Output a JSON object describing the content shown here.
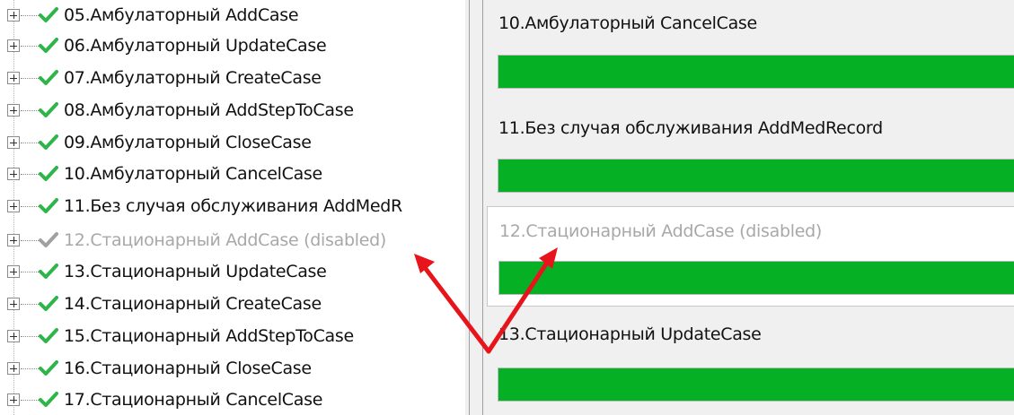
{
  "tree": {
    "items": [
      {
        "label": "05.Амбулаторный AddCase",
        "status": "ok"
      },
      {
        "label": "06.Амбулаторный UpdateCase",
        "status": "ok"
      },
      {
        "label": "07.Амбулаторный CreateCase",
        "status": "ok"
      },
      {
        "label": "08.Амбулаторный AddStepToCase",
        "status": "ok"
      },
      {
        "label": "09.Амбулаторный CloseCase",
        "status": "ok"
      },
      {
        "label": "10.Амбулаторный CancelCase",
        "status": "ok"
      },
      {
        "label": "11.Без случая обслуживания AddMedR",
        "status": "ok"
      },
      {
        "label": "12.Стационарный AddCase (disabled)",
        "status": "disabled"
      },
      {
        "label": "13.Стационарный UpdateCase",
        "status": "ok"
      },
      {
        "label": "14.Стационарный CreateCase",
        "status": "ok"
      },
      {
        "label": "15.Стационарный AddStepToCase",
        "status": "ok"
      },
      {
        "label": "16.Стационарный CloseCase",
        "status": "ok"
      },
      {
        "label": "17.Стационарный CancelCase",
        "status": "ok"
      }
    ]
  },
  "detail": {
    "cards": [
      {
        "title": "10.Амбулаторный CancelCase",
        "progress": 1.0,
        "disabled": false
      },
      {
        "title": "11.Без случая обслуживания AddMedRecord",
        "progress": 1.0,
        "disabled": false
      },
      {
        "title": "12.Стационарный AddCase (disabled)",
        "progress": 1.0,
        "disabled": true
      },
      {
        "title": "13.Стационарный UpdateCase",
        "progress": 1.0,
        "disabled": false
      }
    ]
  },
  "colors": {
    "check_ok": "#2db54a",
    "check_disabled": "#a0a0a0",
    "progress_fill": "#06b025",
    "annotation_arrow": "#e8141c",
    "disabled_text": "#a8a8a8"
  },
  "icons": {
    "expander": "plus-box-icon",
    "status_ok": "checkmark-icon",
    "status_disabled": "checkmark-gray-icon"
  }
}
